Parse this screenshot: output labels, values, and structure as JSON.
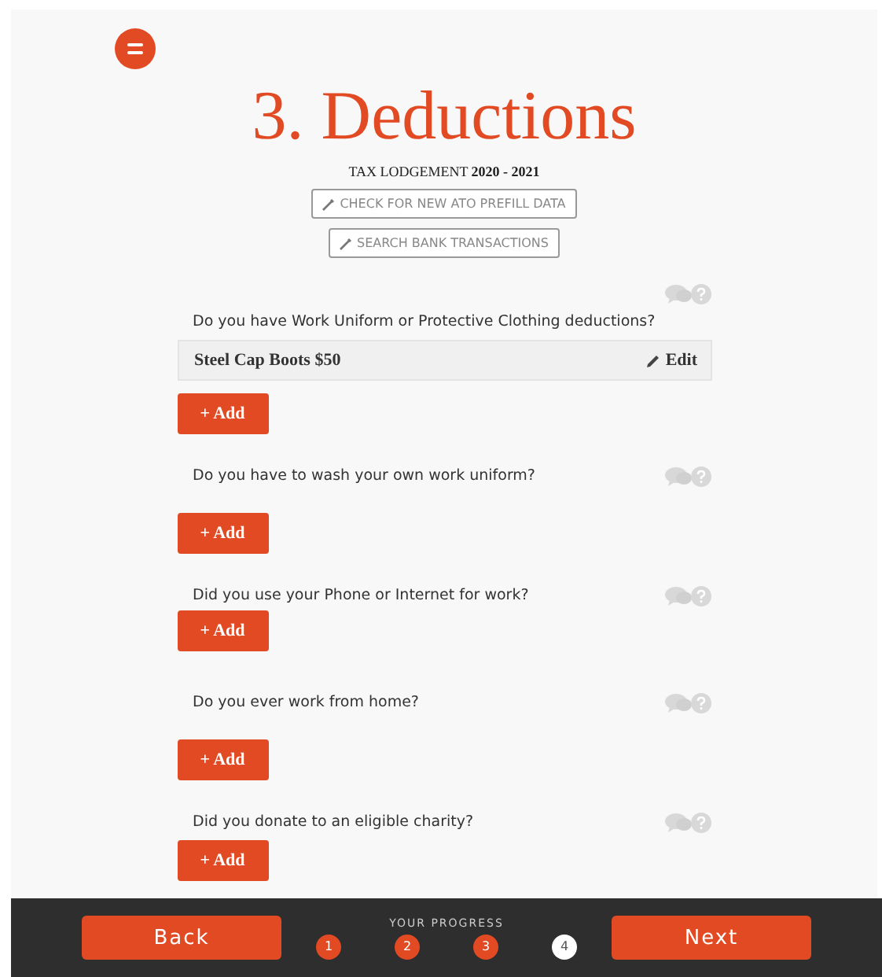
{
  "header": {
    "title": "3. Deductions",
    "subtitle": "TAX LODGEMENT **2020 - 2021**",
    "actions": [
      "CHECK FOR NEW ATO PREFILL DATA",
      "SEARCH BANK TRANSACTIONS"
    ]
  },
  "questions": [
    {
      "question": "Do you have Work Uniform or Protective Clothing deductions?",
      "items": [
        {
          "text": "Steel Cap Boots $50",
          "action": "Edit"
        }
      ],
      "add": "+ Add"
    },
    {
      "question": "Do you have to wash your own work uniform?",
      "add": "+ Add"
    },
    {
      "question": "Did you use your Phone or Internet for work?",
      "add": "+ Add"
    },
    {
      "question": "Do you ever work from home?",
      "add": "+ Add"
    },
    {
      "question": "Did you donate to an eligible charity?",
      "add": "+ Add"
    }
  ],
  "footer": {
    "back": "Back",
    "progress_label": "YOUR PROGRESS",
    "steps": [
      {
        "label": "1",
        "selected": false
      },
      {
        "label": "2",
        "selected": false
      },
      {
        "label": "3",
        "selected": false
      },
      {
        "label": "4",
        "selected": true
      }
    ],
    "next": "Next"
  }
}
